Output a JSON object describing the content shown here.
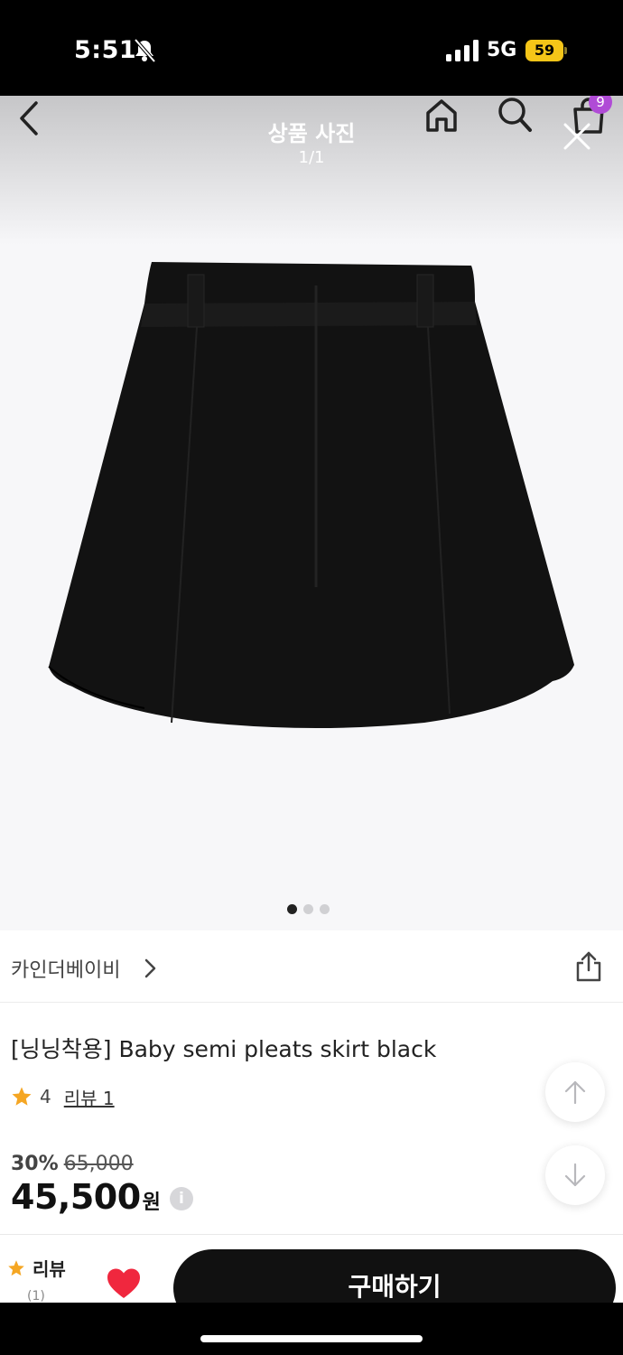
{
  "status_bar": {
    "time": "5:51",
    "network": "5G",
    "battery": "59"
  },
  "header": {
    "title": "상품 사진",
    "counter": "1/1",
    "cart_count": "9"
  },
  "gallery": {
    "slide_count": 3,
    "active_index": 0,
    "product_color": "#121212"
  },
  "brand": {
    "name": "카인더베이비"
  },
  "product": {
    "title": "[닝닝착용] Baby semi pleats skirt black",
    "rating": "4",
    "review_link": "리뷰 1"
  },
  "price": {
    "discount_rate": "30%",
    "original": "65,000",
    "sale": "45,500",
    "currency": "원",
    "info_glyph": "i"
  },
  "bottom_bar": {
    "review_label": "리뷰",
    "review_count": "(1)",
    "buy_label": "구매하기"
  },
  "colors": {
    "star": "#f5a623",
    "heart": "#f0273e",
    "cart_badge": "#b04bd6",
    "battery": "#f5c518"
  }
}
